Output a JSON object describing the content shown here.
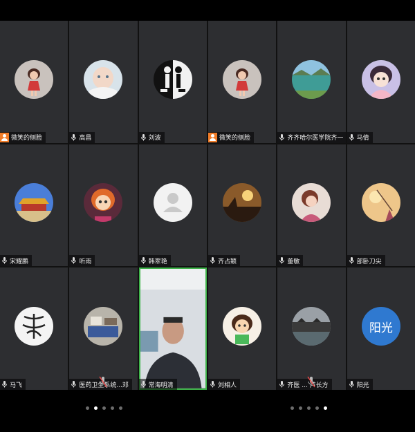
{
  "colors": {
    "tile_bg": "#2d2e31",
    "active_border": "#3fb34a",
    "host_badge": "#f07c28",
    "text_avatar_bg": "#2f79d0"
  },
  "participants": [
    {
      "name": "微笑的侧脸",
      "host": true,
      "avatar_icon": "doll-photo-avatar-icon"
    },
    {
      "name": "高昌",
      "host": false,
      "avatar_icon": "baby-photo-avatar-icon"
    },
    {
      "name": "刘波",
      "host": false,
      "avatar_icon": "black-white-art-avatar-icon"
    },
    {
      "name": "微笑的侧脸",
      "host": true,
      "avatar_icon": "doll-photo-avatar-icon"
    },
    {
      "name": "齐齐哈尔医学院齐一",
      "host": false,
      "avatar_icon": "lake-landscape-avatar-icon"
    },
    {
      "name": "马倩",
      "host": false,
      "avatar_icon": "cartoon-girl-avatar-icon"
    },
    {
      "name": "宋耀鹏",
      "host": false,
      "avatar_icon": "palace-avatar-icon"
    },
    {
      "name": "听雨",
      "host": false,
      "avatar_icon": "cartoon-doll-avatar-icon"
    },
    {
      "name": "韩翠艳",
      "host": false,
      "avatar_icon": "default-user-avatar-icon"
    },
    {
      "name": "齐占颖",
      "host": false,
      "avatar_icon": "sunset-avatar-icon"
    },
    {
      "name": "董敏",
      "host": false,
      "avatar_icon": "illustrated-girl-avatar-icon"
    },
    {
      "name": "部卧刀尖",
      "host": false,
      "avatar_icon": "fishing-sunset-avatar-icon"
    },
    {
      "name": "马飞",
      "host": false,
      "avatar_icon": "calligraphy-avatar-icon"
    },
    {
      "name": "医药卫生系统...邓",
      "host": false,
      "avatar_icon": "room-photo-avatar-icon",
      "muted": true
    },
    {
      "name": "常海明清",
      "host": false,
      "avatar_icon": "camera-video-feed",
      "active": true
    },
    {
      "name": "刘相人",
      "host": false,
      "avatar_icon": "cartoon-kid-avatar-icon"
    },
    {
      "name": "齐医 ... 卢长方",
      "host": false,
      "avatar_icon": "lakeside-village-avatar-icon",
      "muted": true
    },
    {
      "name": "阳光",
      "host": false,
      "avatar_text": "阳光"
    }
  ],
  "pager_left": {
    "count": 5,
    "active": 1
  },
  "pager_right": {
    "count": 5,
    "active": 4
  }
}
